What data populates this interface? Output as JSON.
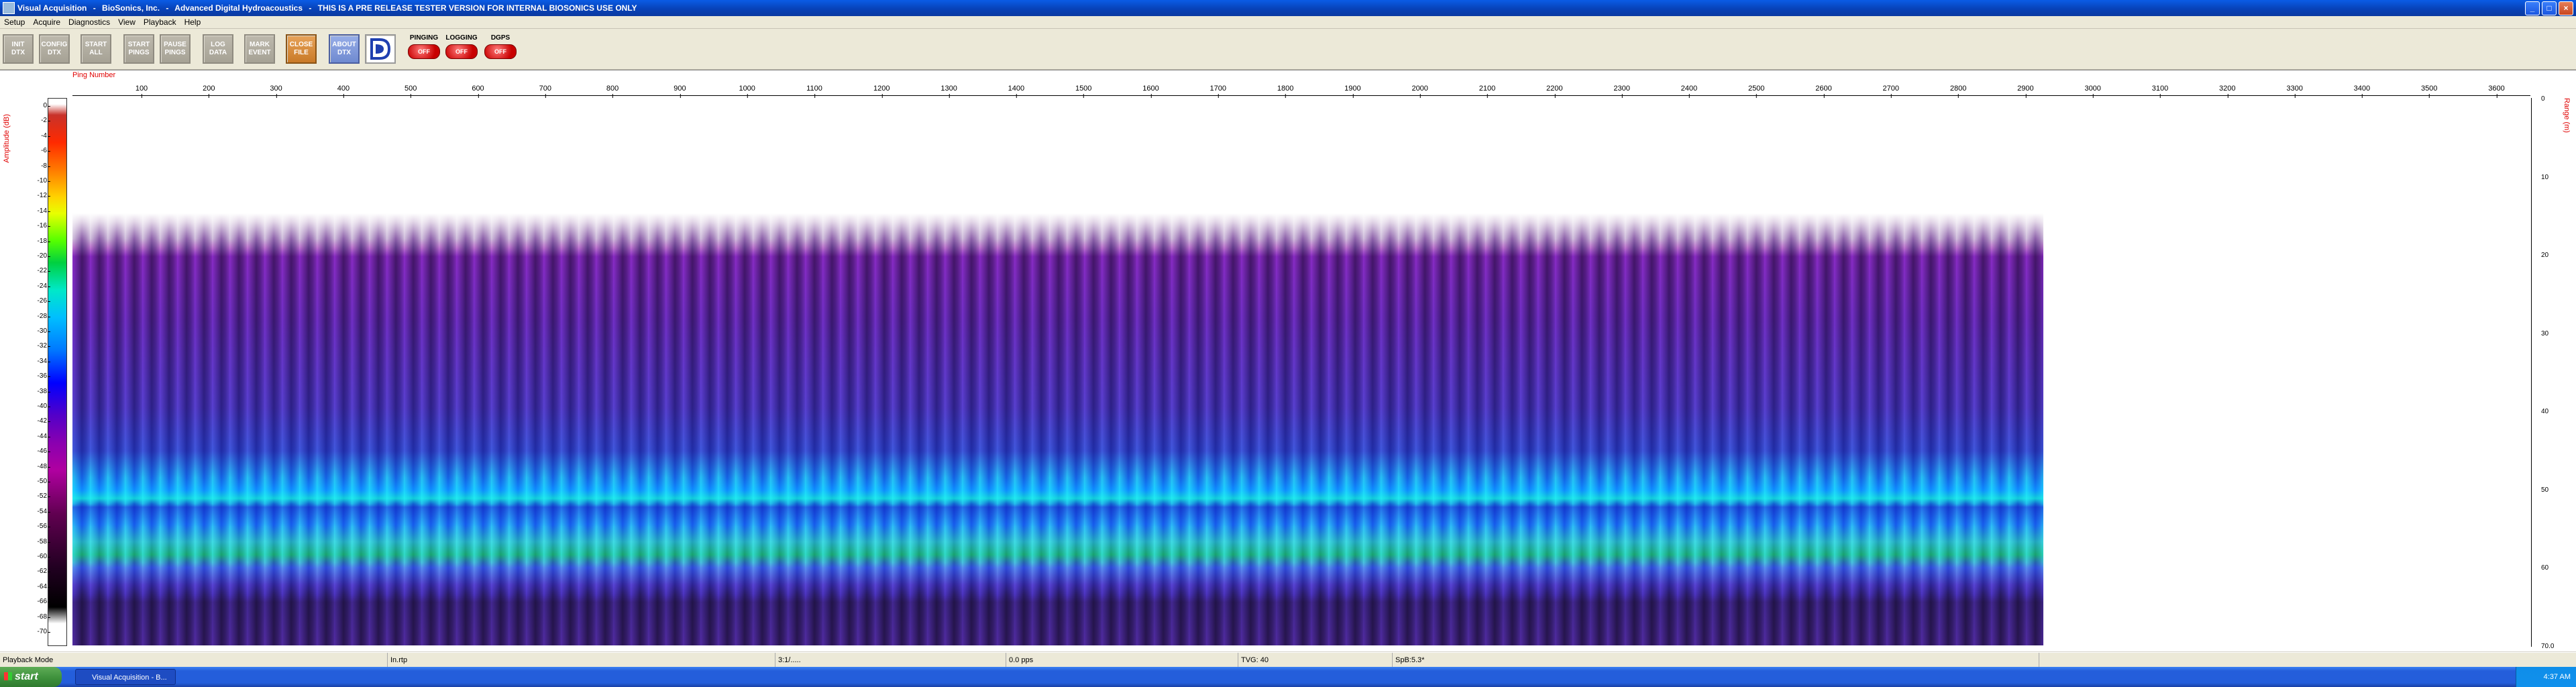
{
  "window": {
    "title_parts": [
      "Visual Acquisition",
      "BioSonics, Inc.",
      "Advanced Digital Hydroacoustics",
      "THIS IS A PRE RELEASE TESTER VERSION FOR INTERNAL BIOSONICS USE ONLY"
    ],
    "separator": "-"
  },
  "menu": [
    "Setup",
    "Acquire",
    "Diagnostics",
    "View",
    "Playback",
    "Help"
  ],
  "toolbar": {
    "buttons": [
      {
        "l1": "INIT",
        "l2": "DTX"
      },
      {
        "l1": "CONFIG",
        "l2": "DTX"
      },
      {
        "l1": "START",
        "l2": "ALL"
      },
      {
        "l1": "START",
        "l2": "PINGS"
      },
      {
        "l1": "PAUSE",
        "l2": "PINGS"
      },
      {
        "l1": "LOG",
        "l2": "DATA"
      },
      {
        "l1": "MARK",
        "l2": "EVENT"
      },
      {
        "l1": "CLOSE",
        "l2": "FILE"
      },
      {
        "l1": "ABOUT",
        "l2": "DTX"
      }
    ],
    "status": [
      {
        "label": "PINGING",
        "state": "OFF"
      },
      {
        "label": "LOGGING",
        "state": "OFF"
      },
      {
        "label": "DGPS",
        "state": "OFF"
      }
    ]
  },
  "plot": {
    "x_axis_label": "Ping Number",
    "x_ticks": [
      "100",
      "200",
      "300",
      "400",
      "500",
      "600",
      "700",
      "800",
      "900",
      "1000",
      "1100",
      "1200",
      "1300",
      "1400",
      "1500",
      "1600",
      "1700",
      "1800",
      "1900",
      "2000",
      "2100",
      "2200",
      "2300",
      "2400",
      "2500",
      "2600",
      "2700",
      "2800",
      "2900",
      "3000",
      "3100",
      "3200",
      "3300",
      "3400",
      "3500",
      "3600"
    ],
    "left_label": "Amplitude (dB)",
    "right_label": "Range (m)",
    "colorbar_ticks": [
      "0",
      "-2",
      "-4",
      "-6",
      "-8",
      "-10",
      "-12",
      "-14",
      "-16",
      "-18",
      "-20",
      "-22",
      "-24",
      "-26",
      "-28",
      "-30",
      "-32",
      "-34",
      "-36",
      "-38",
      "-40",
      "-42",
      "-44",
      "-46",
      "-48",
      "-50",
      "-52",
      "-54",
      "-56",
      "-58",
      "-60",
      "-62",
      "-64",
      "-66",
      "-68",
      "-70"
    ],
    "range_ticks": [
      "0",
      "10",
      "20",
      "30",
      "40",
      "50",
      "60",
      "70.0"
    ]
  },
  "status_bar": {
    "mode": "Playback Mode",
    "file": "In.rtp",
    "time": "3:1/.....",
    "rate": "0.0 pps",
    "tvg": "TVG: 40",
    "spl": "SpB:5.3*"
  },
  "taskbar": {
    "start": "start",
    "item": "Visual Acquisition - B...",
    "clock": "4:37 AM"
  }
}
